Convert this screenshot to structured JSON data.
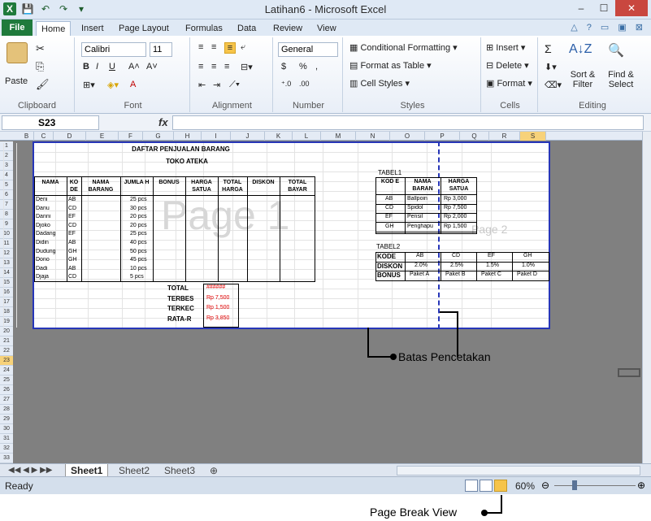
{
  "window": {
    "title": "Latihan6 - Microsoft Excel",
    "min": "–",
    "max": "☐",
    "close": "✕",
    "help_icons": "△ ? ▭ ▣ ⊠"
  },
  "ribbon_tabs": [
    "File",
    "Home",
    "Insert",
    "Page Layout",
    "Formulas",
    "Data",
    "Review",
    "View"
  ],
  "ribbon": {
    "clipboard": {
      "paste": "Paste",
      "label": "Clipboard"
    },
    "font": {
      "name": "Calibri",
      "size": "11",
      "label": "Font",
      "bold": "B",
      "italic": "I",
      "underline": "U",
      "grow": "A˄",
      "shrink": "A˅",
      "color": "A"
    },
    "alignment": {
      "label": "Alignment"
    },
    "number": {
      "format": "General",
      "currency": "$",
      "percent": "%",
      "comma": ",",
      "label": "Number"
    },
    "styles": {
      "conditional": "Conditional Formatting",
      "table": "Format as Table",
      "cell_styles": "Cell Styles",
      "label": "Styles"
    },
    "cells": {
      "insert": "Insert",
      "delete": "Delete",
      "format": "Format",
      "label": "Cells"
    },
    "editing": {
      "sum": "Σ",
      "sort": "Sort & Filter",
      "find": "Find & Select",
      "label": "Editing"
    }
  },
  "formula_bar": {
    "name_box": "S23",
    "fx": "fx",
    "value": ""
  },
  "columns": [
    "B",
    "C",
    "D",
    "E",
    "F",
    "G",
    "H",
    "I",
    "J",
    "K",
    "L",
    "M",
    "N",
    "O",
    "P",
    "Q",
    "R",
    "S"
  ],
  "rows": [
    "1",
    "2",
    "3",
    "4",
    "5",
    "6",
    "7",
    "8",
    "9",
    "10",
    "11",
    "12",
    "13",
    "14",
    "15",
    "16",
    "17",
    "18",
    "19",
    "20",
    "21",
    "22",
    "23",
    "24",
    "25",
    "26",
    "27",
    "28",
    "29",
    "30",
    "31",
    "32",
    "33"
  ],
  "sheet": {
    "title1": "DAFTAR PENJUALAN BARANG",
    "title2": "TOKO ATEKA",
    "headers": [
      "NAMA",
      "KO DE",
      "NAMA BARANG",
      "JUMLA H",
      "BONUS",
      "HARGA SATUA",
      "TOTAL HARGA",
      "DISKON",
      "TOTAL BAYAR"
    ],
    "data": [
      [
        "Deni",
        "AB",
        "25 pcs"
      ],
      [
        "Danu",
        "CD",
        "30 pcs"
      ],
      [
        "Danni",
        "EF",
        "20 pcs"
      ],
      [
        "Djoko",
        "CD",
        "20 pcs"
      ],
      [
        "Dadang",
        "EF",
        "25 pcs"
      ],
      [
        "Didin",
        "AB",
        "40 pcs"
      ],
      [
        "Dudung",
        "GH",
        "50 pcs"
      ],
      [
        "Dono",
        "GH",
        "45 pcs"
      ],
      [
        "Dadi",
        "AB",
        "10 pcs"
      ],
      [
        "Djaja",
        "CD",
        "5 pcs"
      ]
    ],
    "summary": [
      {
        "label": "TOTAL",
        "value": "######"
      },
      {
        "label": "TERBES",
        "value": "Rp 7,500"
      },
      {
        "label": "TERKEC",
        "value": "Rp 1,500"
      },
      {
        "label": "RATA-R",
        "value": "Rp 3,850"
      }
    ],
    "tabel1": {
      "title": "TABEL1",
      "headers": [
        "KOD E",
        "NAMA BARAN",
        "HARGA SATUA"
      ],
      "rows": [
        [
          "AB",
          "Ballpoin",
          "Rp 3,000"
        ],
        [
          "CD",
          "Spidol",
          "Rp 7,500"
        ],
        [
          "EF",
          "Pensil",
          "Rp 2,000"
        ],
        [
          "GH",
          "Penghapu",
          "Rp 1,500"
        ]
      ]
    },
    "tabel2": {
      "title": "TABEL2",
      "row_labels": [
        "KODE",
        "DISKON",
        "BONUS"
      ],
      "cols": [
        "AB",
        "CD",
        "EF",
        "GH"
      ],
      "diskon": [
        "2.0%",
        "2.5%",
        "1.5%",
        "1.0%"
      ],
      "bonus": [
        "Paket A",
        "Paket B",
        "Paket C",
        "Paket D"
      ]
    },
    "page1": "Page 1",
    "page2": "Page 2"
  },
  "sheet_tabs": [
    "Sheet1",
    "Sheet2",
    "Sheet3"
  ],
  "status": {
    "ready": "Ready",
    "zoom": "60%"
  },
  "callouts": {
    "batas": "Batas Pencetakan",
    "pagebreak": "Page Break View"
  }
}
